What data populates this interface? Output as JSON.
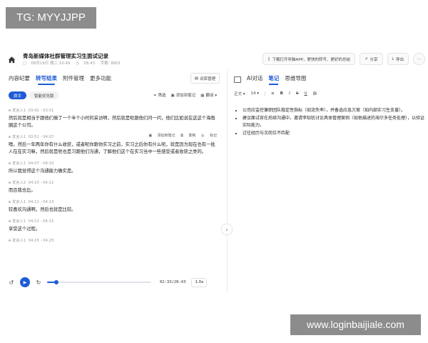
{
  "overlay": {
    "tag": "TG: MYYJJPP",
    "watermark": "www.loginbaijiale.com"
  },
  "header": {
    "title": "青岛新媒体社群管理实习生面试记录",
    "meta_date": "08月19日 周二 10:49",
    "meta_duration": "28:43",
    "meta_words": "字数: 8801",
    "actions": {
      "app_prompt": "下载打开听脑APP，更快的转写、更好的总结",
      "share": "分享",
      "export": "导出",
      "more": "···"
    }
  },
  "left": {
    "tabs": [
      "内容纪要",
      "转写结果",
      "附件管理",
      "更多功能"
    ],
    "active_tab": 1,
    "vocab_button": "词库管理",
    "subtabs": [
      "原文",
      "智能优化版"
    ],
    "tools": {
      "filter": "筛选",
      "add_note": "添加到笔记",
      "translate": "翻译"
    },
    "segments": [
      {
        "speaker": "发言人1",
        "time": "03:42 - 03:51",
        "text": "然后就是相当于跟他们做了一个半个小时的采访啊，然后就是呃跟他们问一问，他们比如说在这这个海角圈这个公司。"
      },
      {
        "speaker": "发言人1",
        "time": "03:51 - 04:07",
        "text": "嗯。然后一年两年你有什么收获，或者呢你跟你实习之前，实习之后你有什么呃，就是因为现在也有一批人在在实习嘛，然后就是呃也是习跟他们沟通，了解他们这个在实习当中一些感受或者收获之类的。",
        "actions": [
          "添加到笔记",
          "复制",
          "标记"
        ]
      },
      {
        "speaker": "发言人1",
        "time": "04:07 - 04:10",
        "text": "所以我觉得这个沟通能力确实是。"
      },
      {
        "speaker": "发言人2",
        "time": "04:10 - 04:11",
        "text": "而且我也比。"
      },
      {
        "speaker": "发言人1",
        "time": "04:11 - 04:13",
        "text": "较喜欢沟通啊，然后也就是比较。"
      },
      {
        "speaker": "发言人1",
        "time": "04:13 - 04:15",
        "text": "享受这个过程。"
      },
      {
        "speaker": "发言人1",
        "time": "04:15 - 04:25",
        "text": ""
      }
    ]
  },
  "player": {
    "current": "02:33",
    "total": "28:43",
    "progress": 0.089,
    "speed": "1.0x"
  },
  "right": {
    "tabs": [
      "AI对话",
      "笔记",
      "思维导图"
    ],
    "active_tab": 1,
    "toolbar": {
      "style": "正文",
      "size": "14",
      "bold": "B",
      "italic": "I",
      "strike": "S",
      "underline": "U"
    },
    "notes": [
      "公司应监控兼职团队稳定性指标（如流失率），并备选应急方案（如内部实习生支援）。",
      "建议面试官在后续沟通中，邀请李知犹讨论具体管理案例（如他描述的海尔多任务处理），以验证实际能力。",
      "过往经历与次岗位不匹配"
    ]
  },
  "colors": {
    "accent": "#1e5bd6",
    "overlay_bg": "#8c8c8c"
  }
}
